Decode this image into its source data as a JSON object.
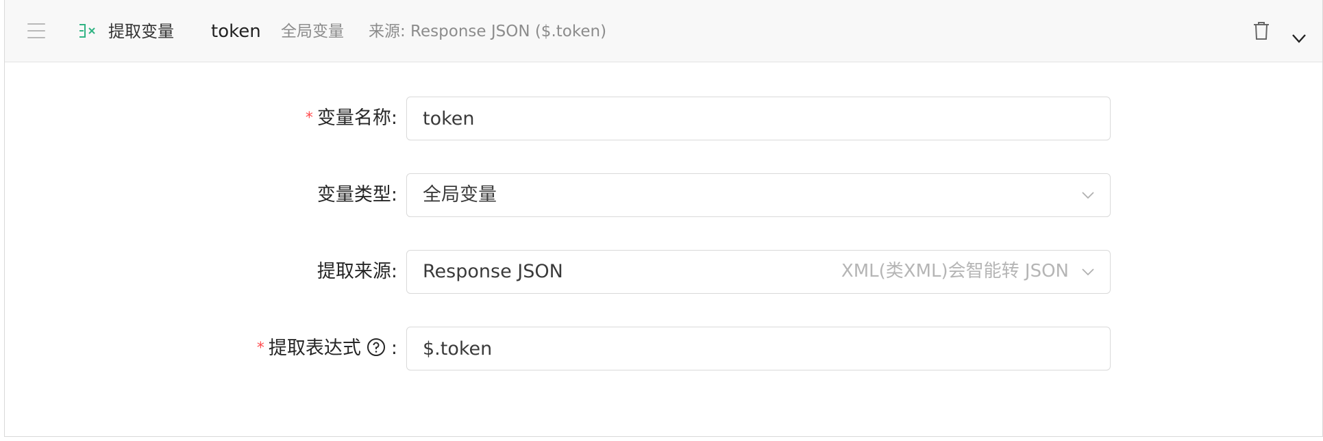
{
  "header": {
    "step_title": "提取变量",
    "var_name": "token",
    "var_type": "全局变量",
    "source_summary": "来源: Response JSON ($.token)",
    "icons": [
      "drag-handle-icon",
      "extract-variable-icon",
      "trash-icon",
      "chevron-down-icon"
    ]
  },
  "form": {
    "variable_name": {
      "label": "变量名称",
      "required": "*",
      "colon": ":",
      "value": "token"
    },
    "variable_type": {
      "label": "变量类型",
      "colon": ":",
      "selected": "全局变量"
    },
    "extract_source": {
      "label": "提取来源",
      "colon": ":",
      "selected": "Response JSON",
      "hint": "XML(类XML)会智能转 JSON"
    },
    "extract_expression": {
      "label": "提取表达式",
      "required": "*",
      "colon": ":",
      "value": "$.token"
    }
  },
  "colors": {
    "accent_green": "#2fb383",
    "required_red": "#ff4d4f",
    "header_bg": "#f8f8f8",
    "border": "#d9d9d9"
  }
}
